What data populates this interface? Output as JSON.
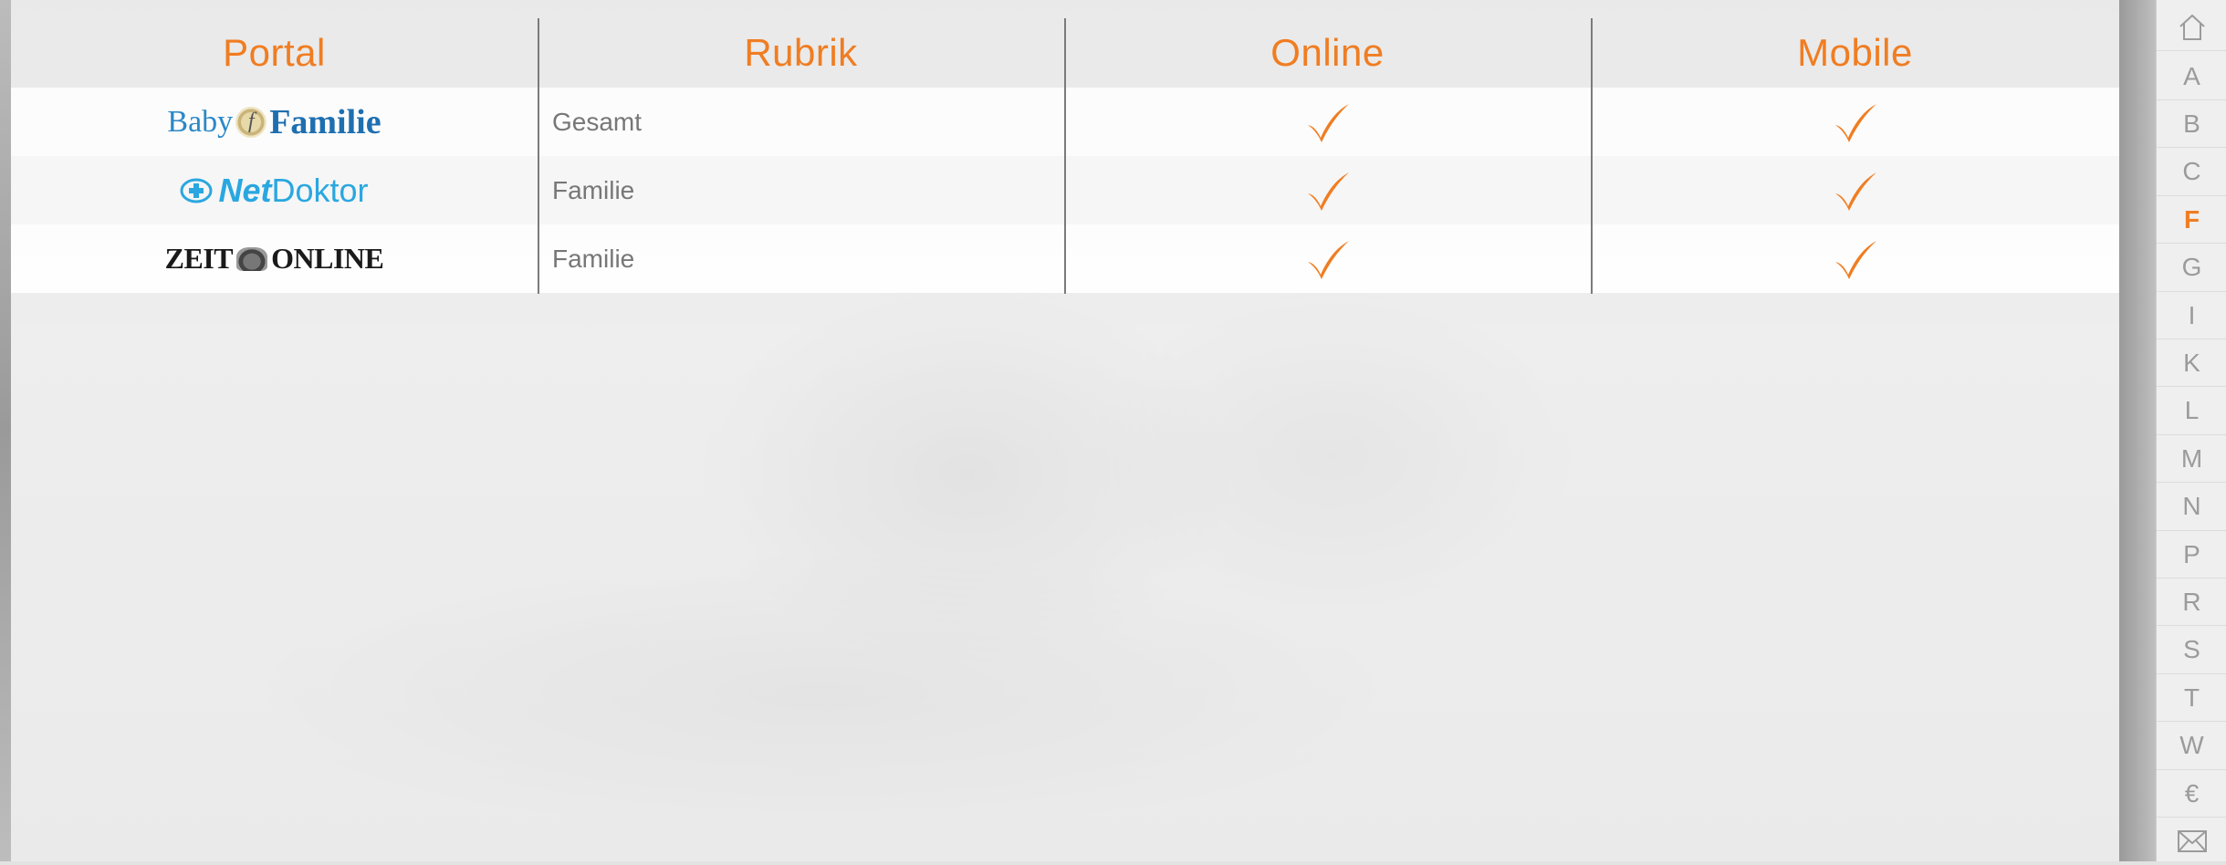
{
  "table": {
    "headers": {
      "portal": "Portal",
      "rubrik": "Rubrik",
      "online": "Online",
      "mobile": "Mobile"
    },
    "rows": [
      {
        "portal_logo": "Baby Familie logo",
        "rubrik": "Gesamt",
        "online": true,
        "mobile": true
      },
      {
        "portal_logo": "NetDoktor logo",
        "rubrik": "Familie",
        "online": true,
        "mobile": true
      },
      {
        "portal_logo": "ZEIT ONLINE logo",
        "rubrik": "Familie",
        "online": true,
        "mobile": true
      }
    ],
    "logos": {
      "babyfamilie": {
        "baby": "Baby",
        "f": "f",
        "familie": "Familie"
      },
      "netdoktor": {
        "net": "Net",
        "doktor": "Doktor"
      },
      "zeit": {
        "zeit": "ZEIT",
        "online": "ONLINE"
      }
    }
  },
  "index_nav": {
    "items": [
      "A",
      "B",
      "C",
      "F",
      "G",
      "I",
      "K",
      "L",
      "M",
      "N",
      "P",
      "R",
      "S",
      "T",
      "W",
      "€"
    ],
    "active": "F",
    "home_icon": "home-icon",
    "mail_icon": "mail-icon"
  },
  "colors": {
    "accent": "#f07d22",
    "text_gray": "#777777",
    "index_gray": "#9b9b9b",
    "netdoktor_blue": "#2aa7e0",
    "babyfamilie_blue": "#1e6fb0"
  }
}
